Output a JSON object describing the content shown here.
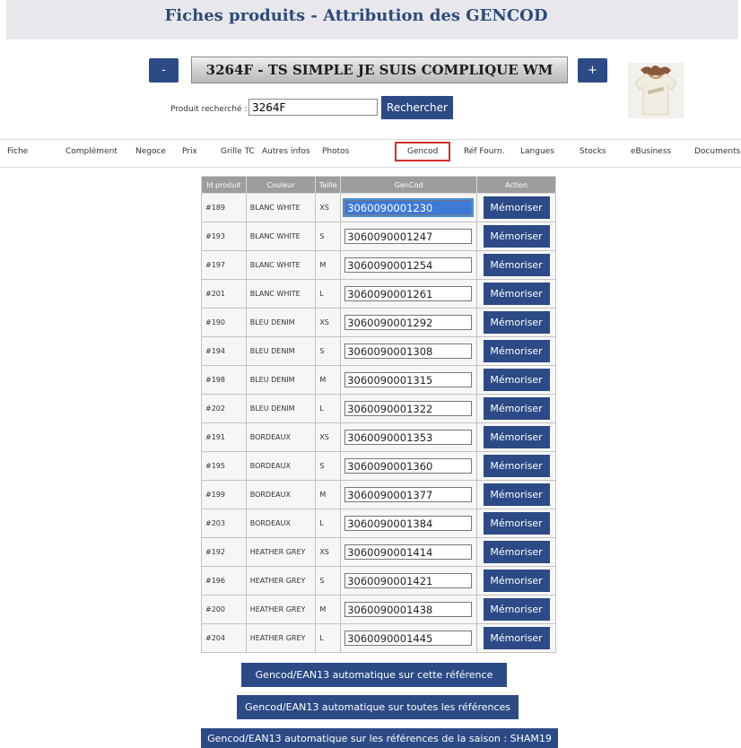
{
  "page": {
    "title": "Fiches produits - Attribution des GENCOD"
  },
  "product": {
    "prev_label": "-",
    "next_label": "+",
    "banner": "3264F - TS SIMPLE JE SUIS COMPLIQUE WM"
  },
  "search": {
    "label": "Produit recherché :",
    "value": "3264F",
    "button_label": "Rechercher"
  },
  "tabs": [
    {
      "label": "Fiche"
    },
    {
      "label": "Complément"
    },
    {
      "label": "Negoce"
    },
    {
      "label": "Prix"
    },
    {
      "label": "Grille TC"
    },
    {
      "label": "Autres infos"
    },
    {
      "label": "Photos"
    },
    {
      "label": "Gencod",
      "active": true
    },
    {
      "label": "Réf Fourn."
    },
    {
      "label": "Langues"
    },
    {
      "label": "Stocks"
    },
    {
      "label": "eBusiness"
    },
    {
      "label": "Documents"
    }
  ],
  "table": {
    "headers": [
      "Id produit",
      "Couleur",
      "Taille",
      "GenCod",
      "Action"
    ],
    "action_label": "Mémoriser",
    "rows": [
      {
        "id": "#189",
        "couleur": "BLANC WHITE",
        "taille": "XS",
        "gencod": "3060090001230"
      },
      {
        "id": "#193",
        "couleur": "BLANC WHITE",
        "taille": "S",
        "gencod": "3060090001247"
      },
      {
        "id": "#197",
        "couleur": "BLANC WHITE",
        "taille": "M",
        "gencod": "3060090001254"
      },
      {
        "id": "#201",
        "couleur": "BLANC WHITE",
        "taille": "L",
        "gencod": "3060090001261"
      },
      {
        "id": "#190",
        "couleur": "BLEU DENIM",
        "taille": "XS",
        "gencod": "3060090001292"
      },
      {
        "id": "#194",
        "couleur": "BLEU DENIM",
        "taille": "S",
        "gencod": "3060090001308"
      },
      {
        "id": "#198",
        "couleur": "BLEU DENIM",
        "taille": "M",
        "gencod": "3060090001315"
      },
      {
        "id": "#202",
        "couleur": "BLEU DENIM",
        "taille": "L",
        "gencod": "3060090001322"
      },
      {
        "id": "#191",
        "couleur": "BORDEAUX",
        "taille": "XS",
        "gencod": "3060090001353"
      },
      {
        "id": "#195",
        "couleur": "BORDEAUX",
        "taille": "S",
        "gencod": "3060090001360"
      },
      {
        "id": "#199",
        "couleur": "BORDEAUX",
        "taille": "M",
        "gencod": "3060090001377"
      },
      {
        "id": "#203",
        "couleur": "BORDEAUX",
        "taille": "L",
        "gencod": "3060090001384"
      },
      {
        "id": "#192",
        "couleur": "HEATHER GREY",
        "taille": "XS",
        "gencod": "3060090001414"
      },
      {
        "id": "#196",
        "couleur": "HEATHER GREY",
        "taille": "S",
        "gencod": "3060090001421"
      },
      {
        "id": "#200",
        "couleur": "HEATHER GREY",
        "taille": "M",
        "gencod": "3060090001438"
      },
      {
        "id": "#204",
        "couleur": "HEATHER GREY",
        "taille": "L",
        "gencod": "3060090001445"
      }
    ]
  },
  "actions": {
    "auto_this_ref": "Gencod/EAN13 automatique sur cette référence",
    "auto_all_refs": "Gencod/EAN13 automatique sur toutes les références",
    "auto_season": "Gencod/EAN13 automatique sur les références de la saison : SHAM19"
  },
  "colors": {
    "accent": "#2c4a85",
    "title": "#2e4a7a",
    "active_tab_border": "#d32f2f",
    "table_header": "#9d9d9d"
  },
  "icons": {
    "product_thumbnail": "tshirt-photo"
  }
}
